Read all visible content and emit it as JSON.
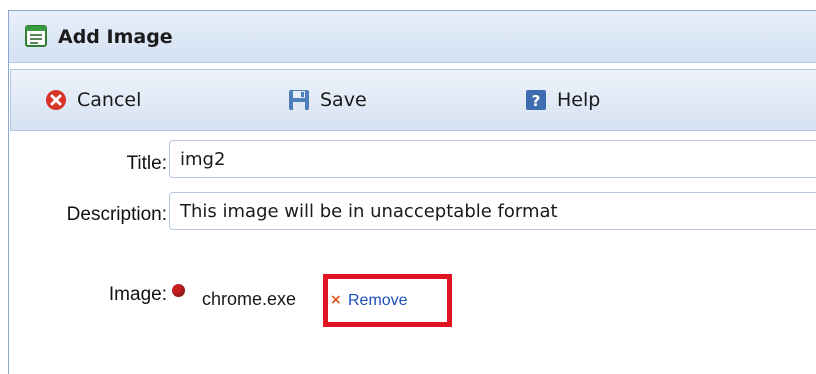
{
  "window": {
    "title": "Add Image"
  },
  "toolbar": {
    "cancel_label": "Cancel",
    "save_label": "Save",
    "help_label": "Help"
  },
  "form": {
    "title_label": "Title:",
    "title_value": "img2",
    "description_label": "Description:",
    "description_value": "This image will be in unacceptable format",
    "image_label": "Image:",
    "file_name": "chrome.exe",
    "remove_x": "×",
    "remove_label": "Remove"
  },
  "colors": {
    "highlight_box": "#e01422",
    "link": "#1b4fb8",
    "remove_x": "#e2521a",
    "status_dot": "#c42222"
  },
  "icons": {
    "title": "window-form-icon",
    "cancel": "cancel-icon",
    "save": "save-icon",
    "help": "help-icon",
    "file_status": "status-dot-icon",
    "remove": "close-icon"
  }
}
